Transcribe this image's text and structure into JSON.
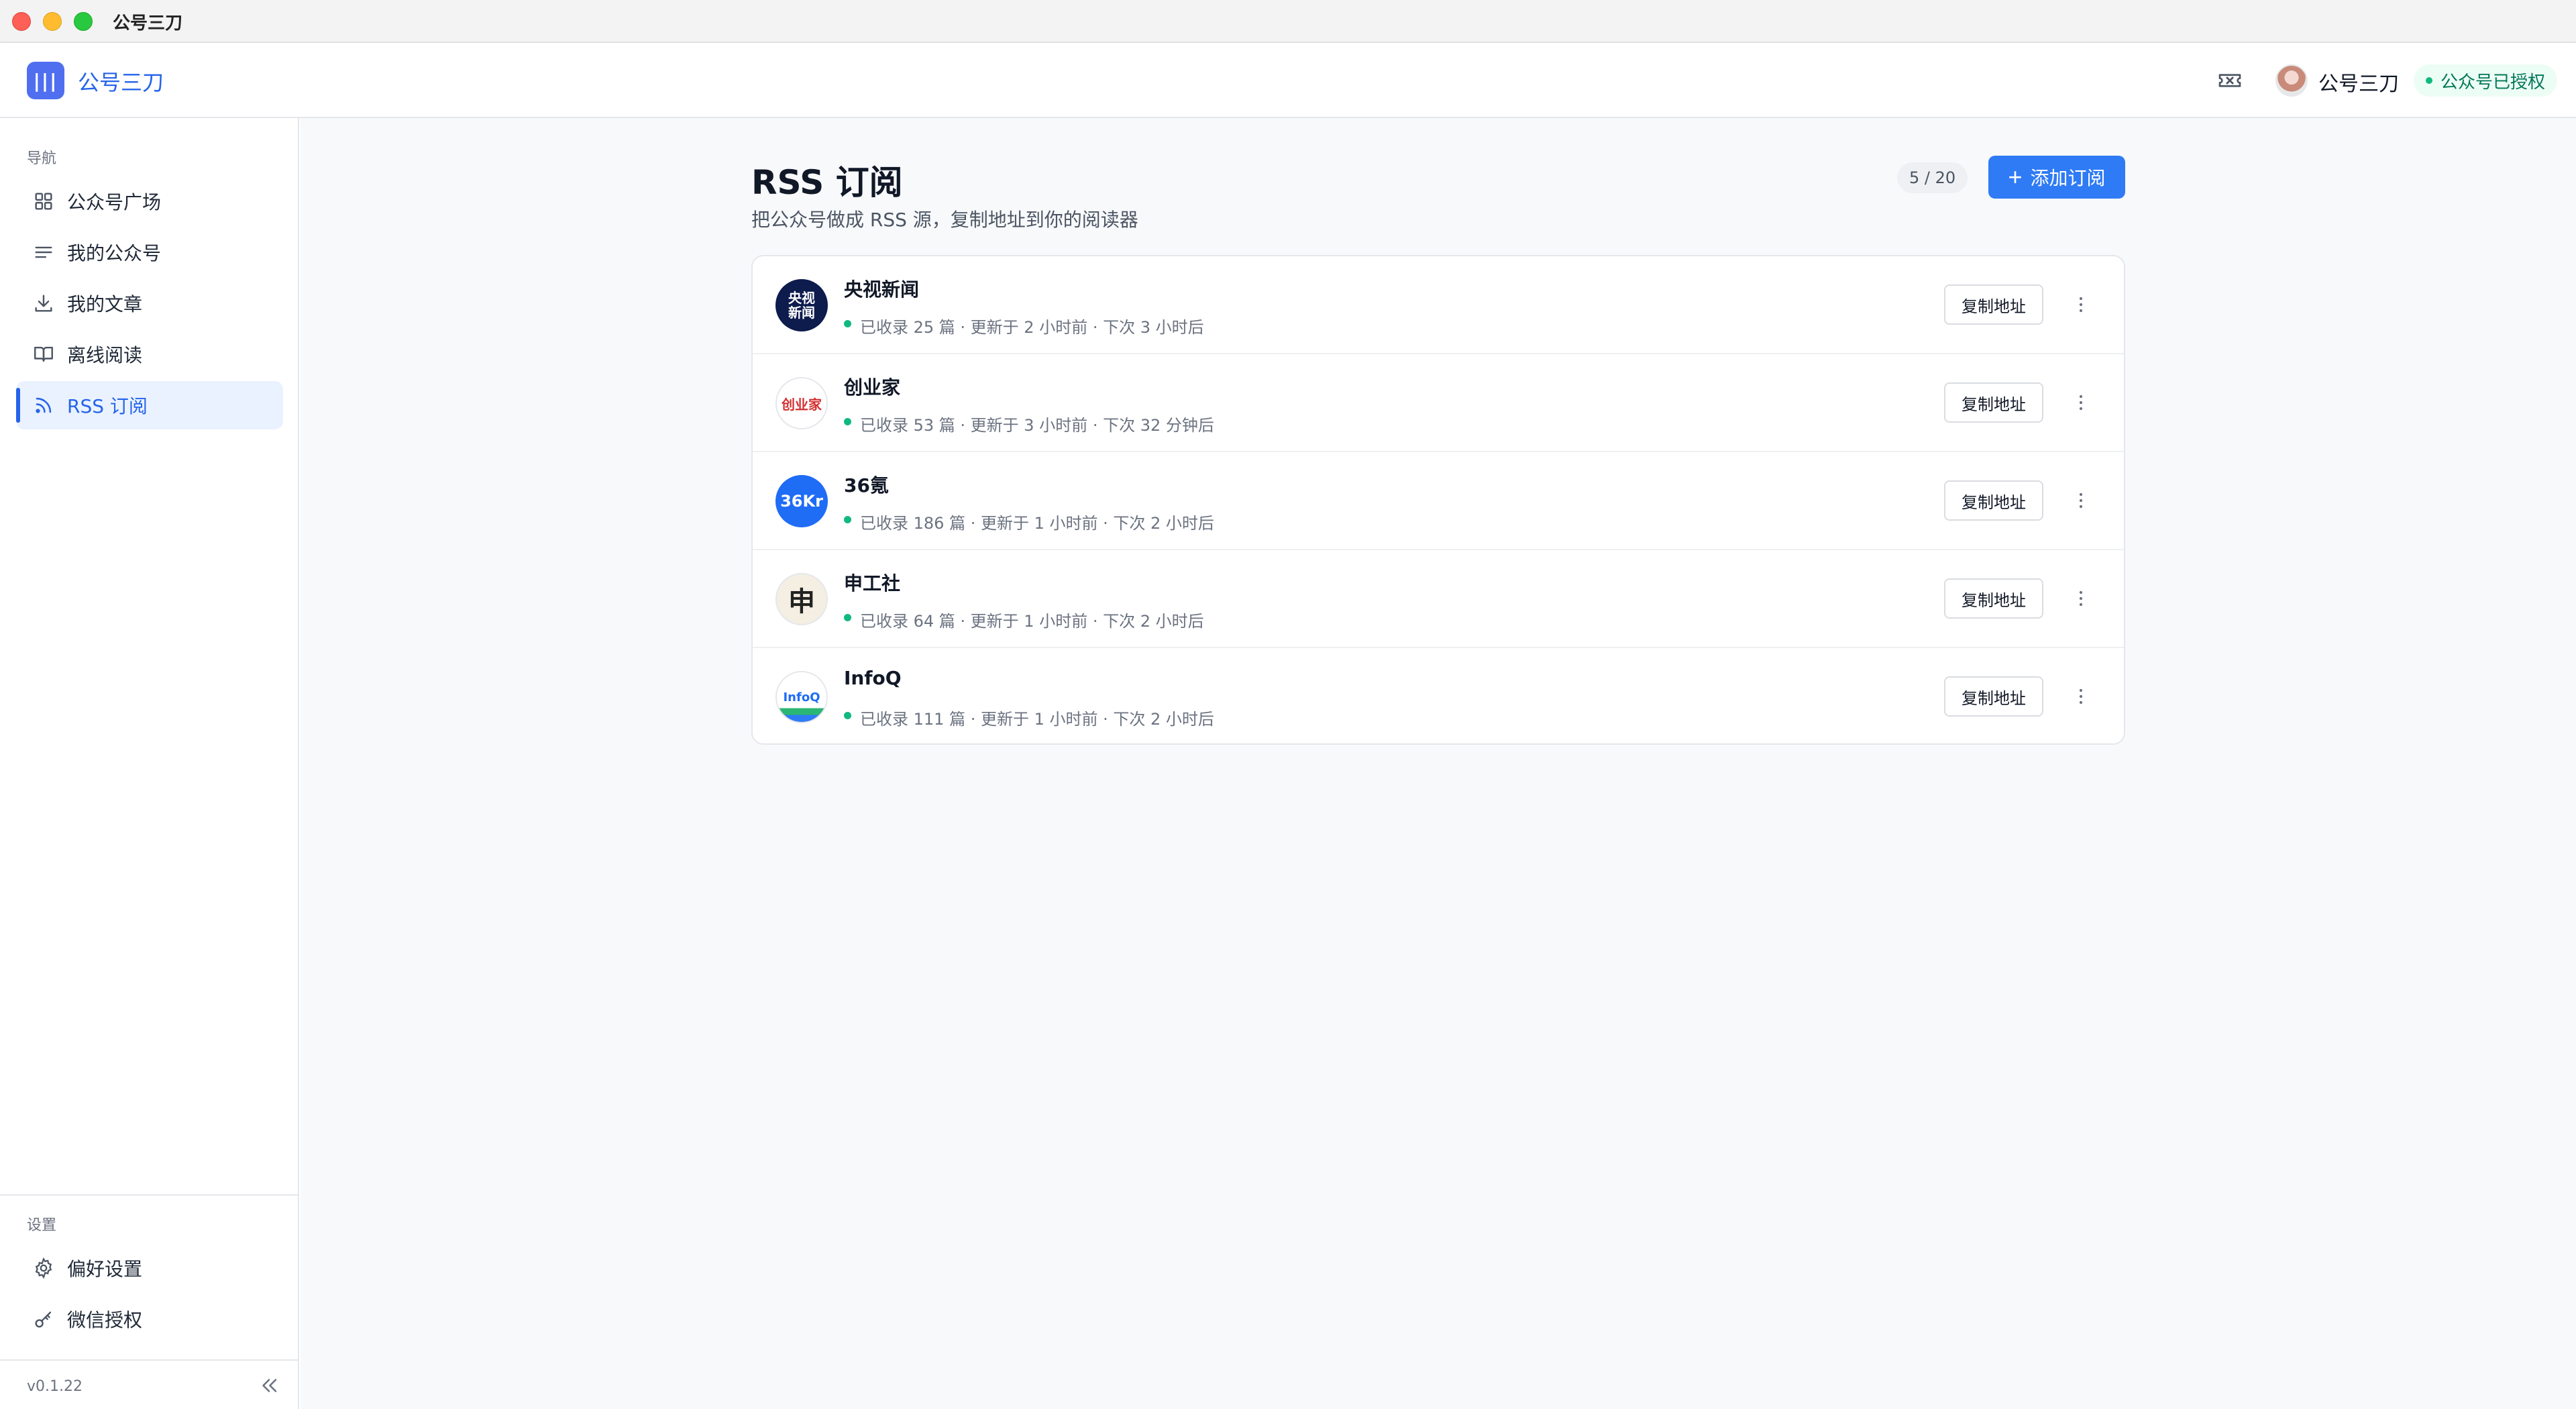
{
  "window": {
    "title": "公号三刀"
  },
  "header": {
    "logo_glyph": "|||",
    "app_name": "公号三刀",
    "user_name": "公号三刀",
    "auth_status": "公众号已授权"
  },
  "sidebar": {
    "nav_label": "导航",
    "items": [
      {
        "label": "公众号广场",
        "icon": "grid-icon"
      },
      {
        "label": "我的公众号",
        "icon": "list-lines-icon"
      },
      {
        "label": "我的文章",
        "icon": "download-icon"
      },
      {
        "label": "离线阅读",
        "icon": "book-icon"
      },
      {
        "label": "RSS 订阅",
        "icon": "rss-icon",
        "active": true
      }
    ],
    "settings_label": "设置",
    "settings_items": [
      {
        "label": "偏好设置",
        "icon": "gear-icon"
      },
      {
        "label": "微信授权",
        "icon": "key-icon"
      }
    ],
    "version": "v0.1.22"
  },
  "main": {
    "title": "RSS 订阅",
    "subtitle": "把公众号做成 RSS 源，复制地址到你的阅读器",
    "quota": "5 / 20",
    "add_button": "添加订阅",
    "copy_label": "复制地址",
    "subscriptions": [
      {
        "name": "央视新闻",
        "meta": "已收录 25 篇 · 更新于 2 小时前 · 下次 3 小时后",
        "avatar_text": "央视新闻"
      },
      {
        "name": "创业家",
        "meta": "已收录 53 篇 · 更新于 3 小时前 · 下次 32 分钟后",
        "avatar_text": "创业家"
      },
      {
        "name": "36氪",
        "meta": "已收录 186 篇 · 更新于 1 小时前 · 下次 2 小时后",
        "avatar_text": "36Kr"
      },
      {
        "name": "申工社",
        "meta": "已收录 64 篇 · 更新于 1 小时前 · 下次 2 小时后",
        "avatar_text": "申"
      },
      {
        "name": "InfoQ",
        "meta": "已收录 111 篇 · 更新于 1 小时前 · 下次 2 小时后",
        "avatar_text": "InfoQ"
      }
    ]
  },
  "colors": {
    "accent": "#2f7bf5",
    "active_bg": "#eaf2ff",
    "status_green": "#10b981"
  }
}
